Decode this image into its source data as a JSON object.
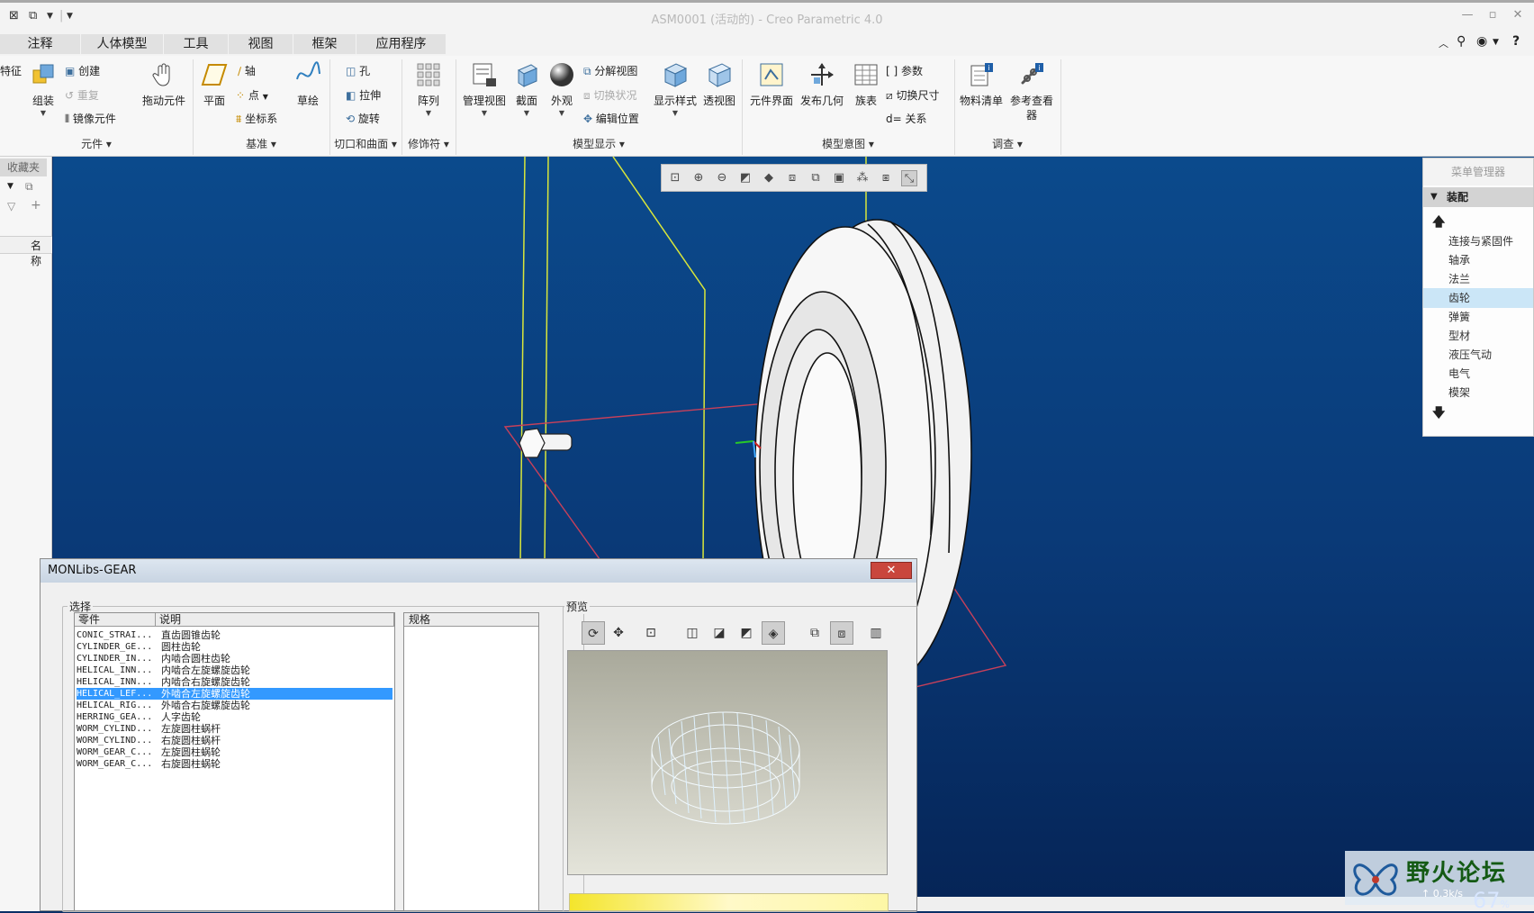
{
  "window": {
    "title": "ASM0001 (活动的) - Creo Parametric 4.0"
  },
  "tabs": [
    "注释",
    "人体模型",
    "工具",
    "视图",
    "框架",
    "应用程序"
  ],
  "ribbon": {
    "groups": {
      "partial_left": "特征",
      "component": {
        "label": "元件",
        "assemble": "组装",
        "create": "创建",
        "repeat": "重复",
        "mirror": "镜像元件",
        "drag": "拖动元件"
      },
      "datum": {
        "label": "基准",
        "plane": "平面",
        "axis": "轴",
        "point": "点",
        "csys": "坐标系",
        "sketch": "草绘"
      },
      "cut": {
        "label": "切口和曲面",
        "hole": "孔",
        "extrude": "拉伸",
        "revolve": "旋转"
      },
      "modifier": {
        "label": "修饰符",
        "pattern": "阵列"
      },
      "display": {
        "label": "模型显示",
        "manage_views": "管理视图",
        "section": "截面",
        "appearance": "外观",
        "explode": "分解视图",
        "toggle_status": "切换状况",
        "edit_position": "编辑位置",
        "display_style": "显示样式",
        "perspective": "透视图"
      },
      "intent": {
        "label": "模型意图",
        "component_interface": "元件界面",
        "publish_geom": "发布几何",
        "family_table": "族表",
        "params": "参数",
        "switch_dims": "切换尺寸",
        "relations": "关系"
      },
      "investigate": {
        "label": "调查",
        "bom": "物料清单",
        "ref_viewer": "参考查看器"
      }
    }
  },
  "left_panel": {
    "favorites": "收藏夹",
    "name_col": "名称"
  },
  "menu_manager": {
    "title": "菜单管理器",
    "header": "装配",
    "items": [
      "连接与紧固件",
      "轴承",
      "法兰",
      "齿轮",
      "弹簧",
      "型材",
      "液压气动",
      "电气",
      "模架"
    ],
    "selected": "齿轮"
  },
  "dialog": {
    "title": "MONLibs-GEAR",
    "select_group": "选择",
    "preview_group": "预览",
    "col_part": "零件",
    "col_desc": "说明",
    "col_spec": "规格",
    "rows": [
      {
        "part": "CONIC_STRAI...",
        "desc": "直齿圆锥齿轮"
      },
      {
        "part": "CYLINDER_GE...",
        "desc": "圆柱齿轮"
      },
      {
        "part": "CYLINDER_IN...",
        "desc": "内啮合圆柱齿轮"
      },
      {
        "part": "HELICAL_INN...",
        "desc": "内啮合左旋螺旋齿轮"
      },
      {
        "part": "HELICAL_INN...",
        "desc": "内啮合右旋螺旋齿轮"
      },
      {
        "part": "HELICAL_LEF...",
        "desc": "外啮合左旋螺旋齿轮"
      },
      {
        "part": "HELICAL_RIG...",
        "desc": "外啮合右旋螺旋齿轮"
      },
      {
        "part": "HERRING_GEA...",
        "desc": "人字齿轮"
      },
      {
        "part": "WORM_CYLIND...",
        "desc": "左旋圆柱蜗杆"
      },
      {
        "part": "WORM_CYLIND...",
        "desc": "右旋圆柱蜗杆"
      },
      {
        "part": "WORM_GEAR_C...",
        "desc": "左旋圆柱蜗轮"
      },
      {
        "part": "WORM_GEAR_C...",
        "desc": "右旋圆柱蜗轮"
      }
    ],
    "selected_index": 5
  },
  "watermark": "野火论坛",
  "status": {
    "net_speed": "0.3k/s",
    "zoom": "67"
  }
}
